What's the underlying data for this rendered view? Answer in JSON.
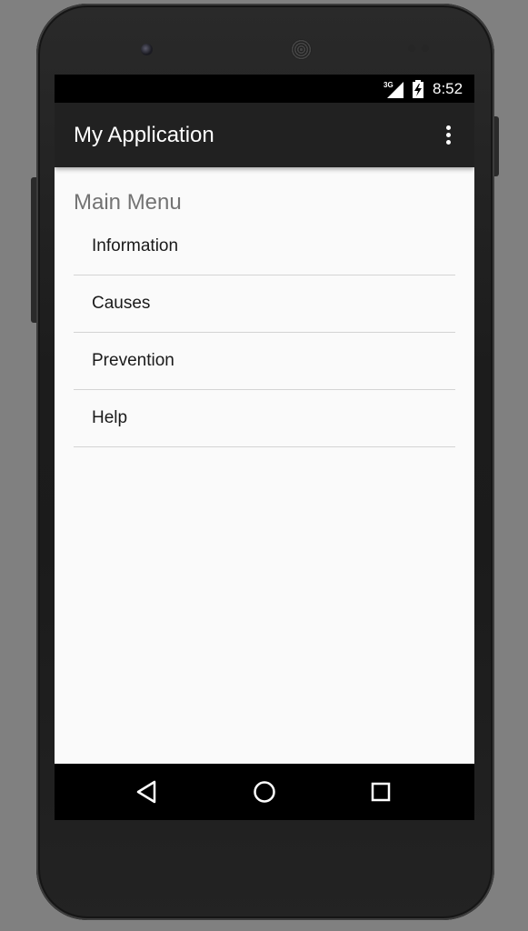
{
  "status_bar": {
    "network": "3G",
    "time": "8:52"
  },
  "app_bar": {
    "title": "My Application",
    "overflow_icon": "more-vert-icon"
  },
  "main": {
    "section_title": "Main Menu",
    "items": [
      {
        "label": "Information"
      },
      {
        "label": "Causes"
      },
      {
        "label": "Prevention"
      },
      {
        "label": "Help"
      }
    ]
  },
  "nav_bar": {
    "back_icon": "back-triangle-icon",
    "home_icon": "home-circle-icon",
    "recents_icon": "recents-square-icon"
  },
  "colors": {
    "app_bar_bg": "#212121",
    "content_bg": "#fafafa",
    "section_title": "#737373",
    "divider": "#d4d4d4"
  }
}
